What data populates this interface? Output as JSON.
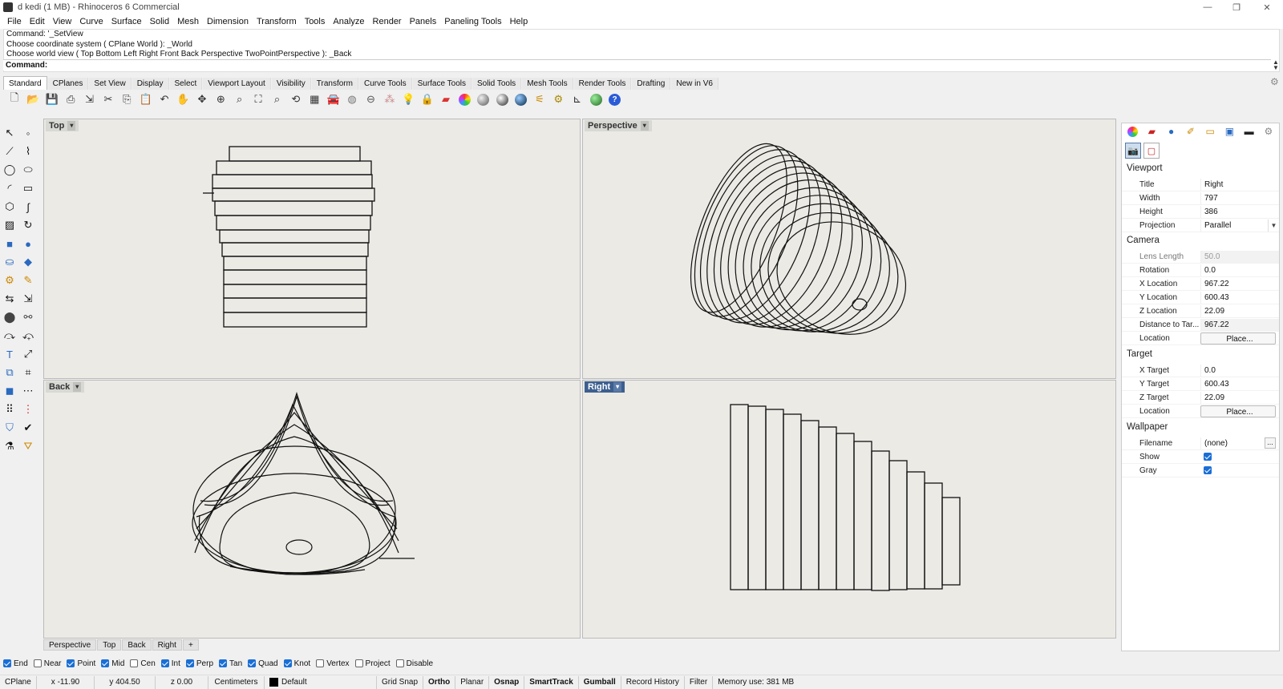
{
  "window": {
    "title": "d kedi (1 MB) - Rhinoceros 6 Commercial",
    "minimize": "—",
    "maximize": "❐",
    "close": "✕"
  },
  "menu": [
    "File",
    "Edit",
    "View",
    "Curve",
    "Surface",
    "Solid",
    "Mesh",
    "Dimension",
    "Transform",
    "Tools",
    "Analyze",
    "Render",
    "Panels",
    "Paneling Tools",
    "Help"
  ],
  "command_history": [
    "Command: '_SetView",
    "Choose coordinate system ( CPlane  World ): _World",
    "Choose world view ( Top  Bottom  Left  Right  Front  Back  Perspective  TwoPointPerspective ): _Back"
  ],
  "command_prompt": "Command:",
  "toolbar_tabs": [
    "Standard",
    "CPlanes",
    "Set View",
    "Display",
    "Select",
    "Viewport Layout",
    "Visibility",
    "Transform",
    "Curve Tools",
    "Surface Tools",
    "Solid Tools",
    "Mesh Tools",
    "Render Tools",
    "Drafting",
    "New in V6"
  ],
  "toolbar_icons": [
    "new-file-icon",
    "open-folder-icon",
    "save-icon",
    "print-icon",
    "import-icon",
    "cut-icon",
    "copy-icon",
    "paste-icon",
    "undo-icon",
    "pan-hand-icon",
    "rotate-view-icon",
    "zoom-in-icon",
    "zoom-window-icon",
    "zoom-extents-icon",
    "zoom-selected-icon",
    "zoom-dynamic-icon",
    "four-viewports-icon",
    "car-render-icon",
    "analysis-icon",
    "cplane-icon",
    "snap-icon",
    "light-icon",
    "lock-icon",
    "layers-icon",
    "color-wheel-icon",
    "shaded-sphere-icon",
    "ghosted-sphere-icon",
    "rendered-sphere-icon",
    "filter-icon",
    "gear-tools-icon",
    "dimension-icon",
    "globe-icon",
    "help-icon"
  ],
  "viewports": {
    "top": {
      "label": "Top"
    },
    "perspective": {
      "label": "Perspective"
    },
    "back": {
      "label": "Back"
    },
    "right": {
      "label": "Right"
    }
  },
  "viewport_tabs": [
    "Perspective",
    "Top",
    "Back",
    "Right"
  ],
  "viewport_tab_add": "+",
  "osnaps": [
    {
      "label": "End",
      "on": true
    },
    {
      "label": "Near",
      "on": false
    },
    {
      "label": "Point",
      "on": true
    },
    {
      "label": "Mid",
      "on": true
    },
    {
      "label": "Cen",
      "on": false
    },
    {
      "label": "Int",
      "on": true
    },
    {
      "label": "Perp",
      "on": true
    },
    {
      "label": "Tan",
      "on": true
    },
    {
      "label": "Quad",
      "on": true
    },
    {
      "label": "Knot",
      "on": true
    },
    {
      "label": "Vertex",
      "on": false
    },
    {
      "label": "Project",
      "on": false
    },
    {
      "label": "Disable",
      "on": false
    }
  ],
  "status": {
    "cplane": "CPlane",
    "x": "x -11.90",
    "y": "y 404.50",
    "z": "z 0.00",
    "units": "Centimeters",
    "layer": "Default",
    "grid_snap": "Grid Snap",
    "ortho": "Ortho",
    "planar": "Planar",
    "osnap": "Osnap",
    "smarttrack": "SmartTrack",
    "gumball": "Gumball",
    "record_history": "Record History",
    "filter": "Filter",
    "memory": "Memory use: 381 MB"
  },
  "properties": {
    "viewport_section": "Viewport",
    "title_label": "Title",
    "title_value": "Right",
    "width_label": "Width",
    "width_value": "797",
    "height_label": "Height",
    "height_value": "386",
    "projection_label": "Projection",
    "projection_value": "Parallel",
    "camera_section": "Camera",
    "lens_label": "Lens Length",
    "lens_value": "50.0",
    "rotation_label": "Rotation",
    "rotation_value": "0.0",
    "xloc_label": "X Location",
    "xloc_value": "967.22",
    "yloc_label": "Y Location",
    "yloc_value": "600.43",
    "zloc_label": "Z Location",
    "zloc_value": "22.09",
    "dist_label": "Distance to Tar...",
    "dist_value": "967.22",
    "location_label": "Location",
    "place_button": "Place...",
    "target_section": "Target",
    "xt_label": "X Target",
    "xt_value": "0.0",
    "yt_label": "Y Target",
    "yt_value": "600.43",
    "zt_label": "Z Target",
    "zt_value": "22.09",
    "tloc_label": "Location",
    "tplace_button": "Place...",
    "wallpaper_section": "Wallpaper",
    "filename_label": "Filename",
    "filename_value": "(none)",
    "filename_button": "...",
    "show_label": "Show",
    "show_on": true,
    "gray_label": "Gray",
    "gray_on": true
  },
  "colors": {
    "viewport_bg": "#ebeae5",
    "active_viewport_label": "#3c5f8e",
    "checkbox_blue": "#1a6fd6"
  }
}
